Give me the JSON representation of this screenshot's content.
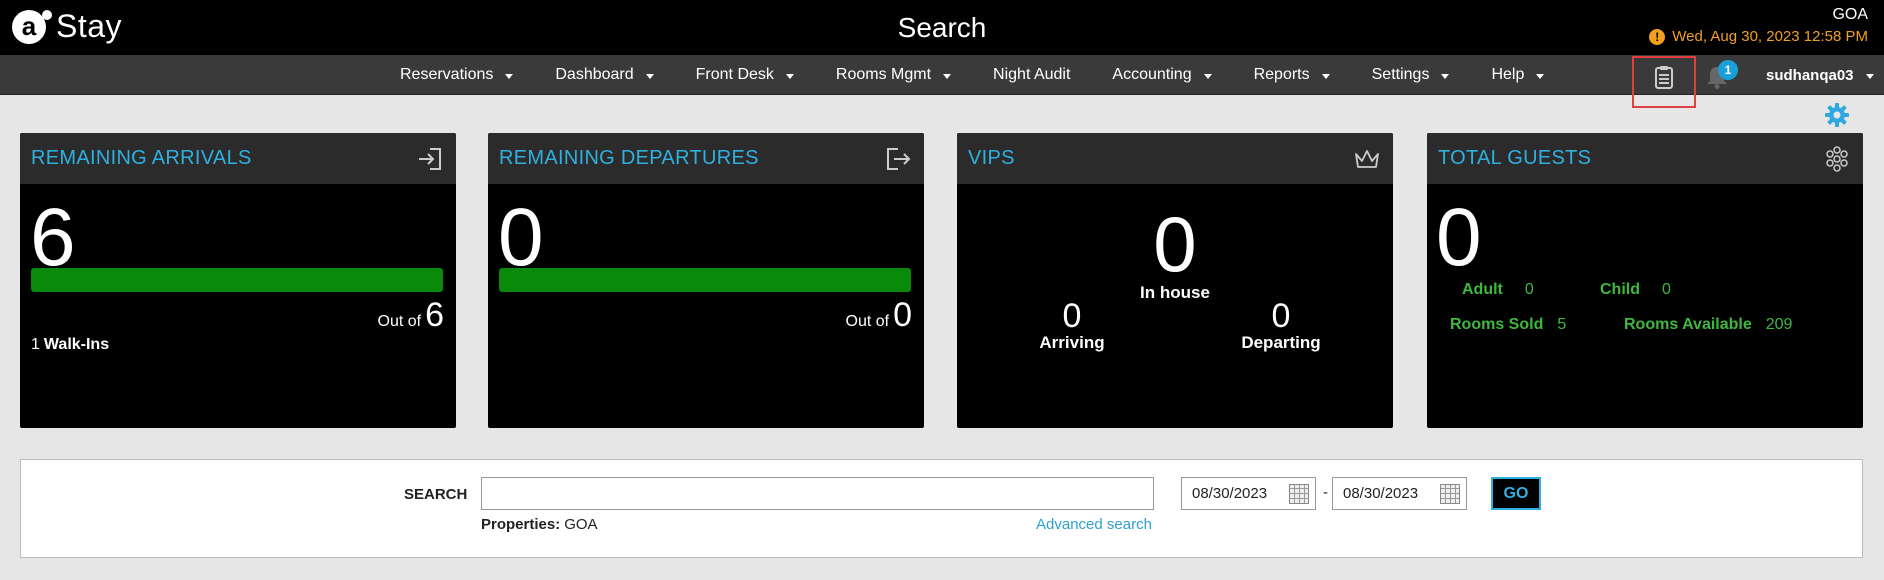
{
  "header": {
    "brand": "Stay",
    "brand_mark": "a",
    "page_title": "Search",
    "property_code": "GOA",
    "datetime": "Wed, Aug 30, 2023 12:58 PM",
    "warning_glyph": "!"
  },
  "nav": {
    "items": [
      {
        "label": "Reservations",
        "dropdown": true
      },
      {
        "label": "Dashboard",
        "dropdown": true
      },
      {
        "label": "Front Desk",
        "dropdown": true
      },
      {
        "label": "Rooms Mgmt",
        "dropdown": true
      },
      {
        "label": "Night Audit",
        "dropdown": false
      },
      {
        "label": "Accounting",
        "dropdown": true
      },
      {
        "label": "Reports",
        "dropdown": true
      },
      {
        "label": "Settings",
        "dropdown": true
      },
      {
        "label": "Help",
        "dropdown": true
      }
    ],
    "notifications_count": "1",
    "username": "sudhanqa03"
  },
  "cards": {
    "arrivals": {
      "title": "REMAINING ARRIVALS",
      "value": "6",
      "out_of_label": "Out of",
      "out_of_value": "6",
      "progress": 1.0,
      "walkins_count": "1",
      "walkins_label": "Walk-Ins"
    },
    "departures": {
      "title": "REMAINING DEPARTURES",
      "value": "0",
      "out_of_label": "Out of",
      "out_of_value": "0",
      "progress": 1.0
    },
    "vips": {
      "title": "VIPS",
      "in_house_value": "0",
      "in_house_label": "In house",
      "arriving_value": "0",
      "arriving_label": "Arriving",
      "departing_value": "0",
      "departing_label": "Departing"
    },
    "guests": {
      "title": "TOTAL GUESTS",
      "value": "0",
      "adult_label": "Adult",
      "adult_value": "0",
      "child_label": "Child",
      "child_value": "0",
      "rooms_sold_label": "Rooms Sold",
      "rooms_sold_value": "5",
      "rooms_available_label": "Rooms Available",
      "rooms_available_value": "209"
    }
  },
  "search": {
    "label": "SEARCH",
    "input_value": "",
    "properties_label": "Properties:",
    "properties_value": "GOA",
    "advanced_link": "Advanced search",
    "date_from": "08/30/2023",
    "date_separator": "-",
    "date_to": "08/30/2023",
    "go_label": "GO"
  },
  "colors": {
    "accent": "#2fb0e0",
    "progress": "#0a8a0a",
    "stat_text": "#3fb83f",
    "warning": "#f0a020"
  }
}
